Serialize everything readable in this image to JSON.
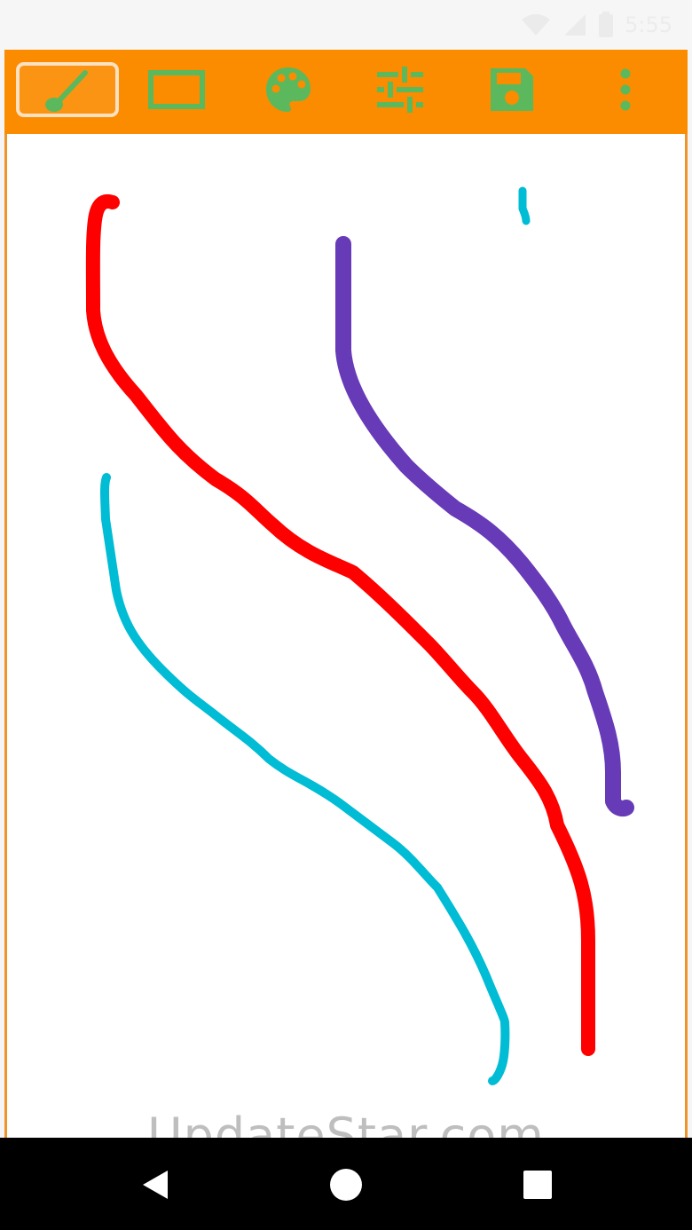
{
  "status_bar": {
    "time": "5:55",
    "icons": [
      "wifi-icon",
      "cellular-signal-icon",
      "battery-icon"
    ]
  },
  "toolbar": {
    "background": "#fb8c00",
    "icon_color": "#5cb85c",
    "tools": [
      {
        "name": "brush",
        "icon": "brush-icon",
        "active": true
      },
      {
        "name": "shape",
        "icon": "rectangle-icon",
        "active": false
      },
      {
        "name": "color",
        "icon": "palette-icon",
        "active": false
      },
      {
        "name": "settings",
        "icon": "tune-sliders-icon",
        "active": false
      },
      {
        "name": "save",
        "icon": "save-floppy-icon",
        "active": false
      },
      {
        "name": "more",
        "icon": "more-vertical-icon",
        "active": false
      }
    ]
  },
  "canvas": {
    "background": "#ffffff",
    "strokes": [
      {
        "color": "#ff0000",
        "name": "red-stroke"
      },
      {
        "color": "#673ab7",
        "name": "purple-stroke"
      },
      {
        "color": "#00bcd4",
        "name": "cyan-stroke"
      },
      {
        "color": "#00bcd4",
        "name": "cyan-dash-stroke"
      }
    ]
  },
  "watermark": "UpdateStar.com",
  "nav_bar": {
    "buttons": [
      "back-icon",
      "home-icon",
      "recents-icon"
    ]
  }
}
